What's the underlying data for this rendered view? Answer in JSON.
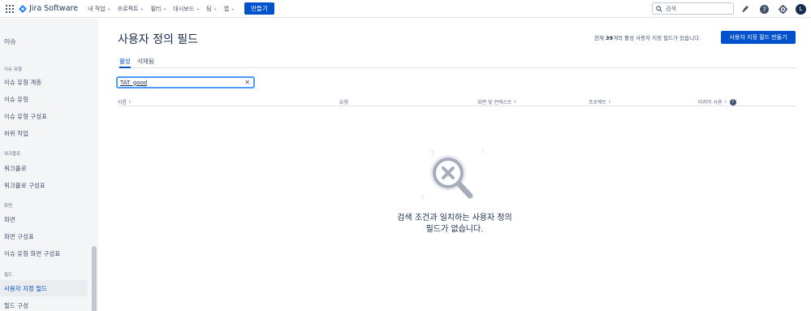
{
  "topnav": {
    "product": "Jira Software",
    "menu": [
      {
        "label": "내 작업"
      },
      {
        "label": "프로젝트"
      },
      {
        "label": "필터"
      },
      {
        "label": "대시보드"
      },
      {
        "label": "팀"
      },
      {
        "label": "앱"
      }
    ],
    "create_label": "만들기",
    "search_placeholder": "검색",
    "avatar_initial": "L"
  },
  "sidebar": {
    "title": "이슈",
    "groups": [
      {
        "label": "이슈 유형",
        "items": [
          {
            "label": "이슈 유형 계층"
          },
          {
            "label": "이슈 유형"
          },
          {
            "label": "이슈 유형 구성표"
          },
          {
            "label": "하위 작업"
          }
        ]
      },
      {
        "label": "워크플로",
        "items": [
          {
            "label": "워크플로"
          },
          {
            "label": "워크플로 구성표"
          }
        ]
      },
      {
        "label": "화면",
        "items": [
          {
            "label": "화면"
          },
          {
            "label": "화면 구성표"
          },
          {
            "label": "이슈 유형 화면 구성표"
          }
        ]
      },
      {
        "label": "필드",
        "items": [
          {
            "label": "사용자 지정 필드",
            "active": true
          },
          {
            "label": "필드 구성"
          }
        ]
      }
    ]
  },
  "main": {
    "title": "사용자 정의 필드",
    "count_prefix": "현재 ",
    "count_value": "39",
    "count_suffix": "개의 활성 사용자 지정 필드가 있습니다.",
    "create_field_label": "사용자 지정 필드 만들기",
    "tabs": [
      {
        "label": "활성",
        "active": true
      },
      {
        "label": "삭제됨"
      }
    ],
    "filter_value": "TAT_good",
    "columns": [
      {
        "label": "이름"
      },
      {
        "label": "유형"
      },
      {
        "label": "화면 및 컨텍스트"
      },
      {
        "label": "프로젝트"
      },
      {
        "label": "마지막 사용"
      }
    ],
    "empty_message_line1": "검색 조건과 일치하는 사용자 정의",
    "empty_message_line2": "필드가 없습니다."
  },
  "colors": {
    "brand_blue": "#0052cc",
    "focus_blue": "#4c9aff",
    "sidebar_bg": "#f4f5f7",
    "text_dark": "#172b4d"
  }
}
